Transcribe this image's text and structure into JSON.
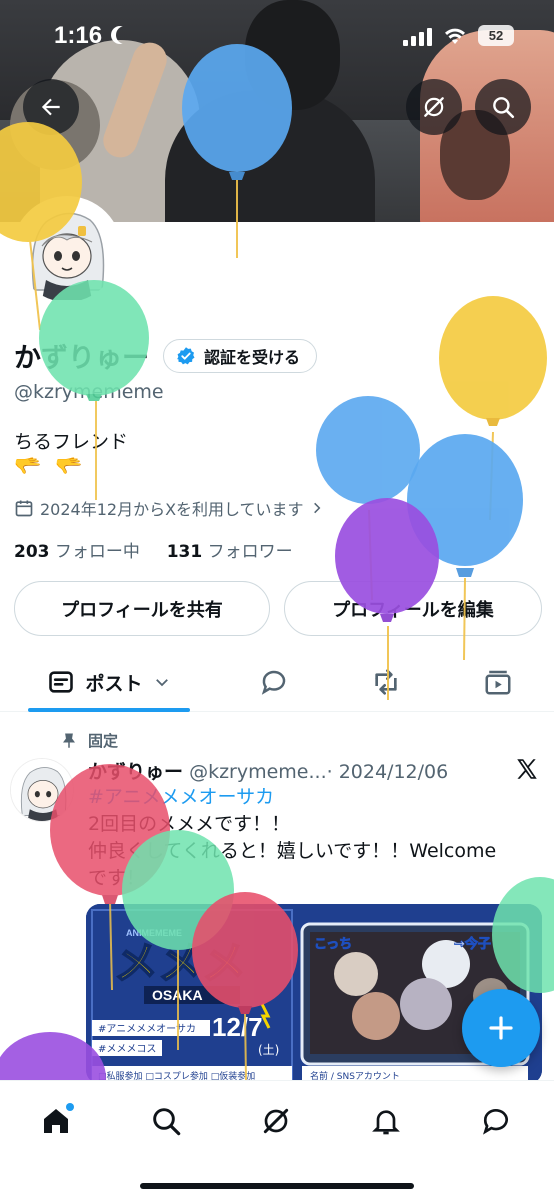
{
  "status_bar": {
    "time": "1:16",
    "battery": "52"
  },
  "profile": {
    "display_name": "かずりゅー",
    "verify_button": "認証を受ける",
    "handle": "@kzrymememe",
    "bio": "ちるフレンド",
    "bio_emoji": "🫳🫳",
    "joined": "2024年12月からXを利用しています",
    "following_count": "203",
    "following_label": "フォロー中",
    "followers_count": "131",
    "followers_label": "フォロワー"
  },
  "actions": {
    "share": "プロフィールを共有",
    "edit": "プロフィールを編集"
  },
  "tabs": {
    "posts": "ポスト"
  },
  "pinned_post": {
    "pinned_label": "固定",
    "author_name": "かずりゅー",
    "author_handle": "@kzrymeme...",
    "date": "· 2024/12/06",
    "hashtag": "#アニメメメオーサカ",
    "line1": "2回目のメメメです！！",
    "line2": "仲良くしてくれると！嬉しいです！！Welcome",
    "line3": "です！",
    "media": {
      "logo": "メメメ",
      "logo_sub": "OSAKA",
      "brand_top": "ANIMEMEME",
      "tag1": "#アニメメメオーサカ",
      "tag2": "#メメメコス",
      "date_big": "12/7",
      "day": "(土)",
      "options": "□私服参加 □コスプレ参加 □仮装参加",
      "name_label": "名前 / SNSアカウント",
      "sticker_left": "こっち",
      "sticker_right": "→今子"
    }
  },
  "colors": {
    "accent": "#1d9bf0",
    "text": "#0f1419",
    "muted": "#536471",
    "border": "#cfd9de"
  }
}
